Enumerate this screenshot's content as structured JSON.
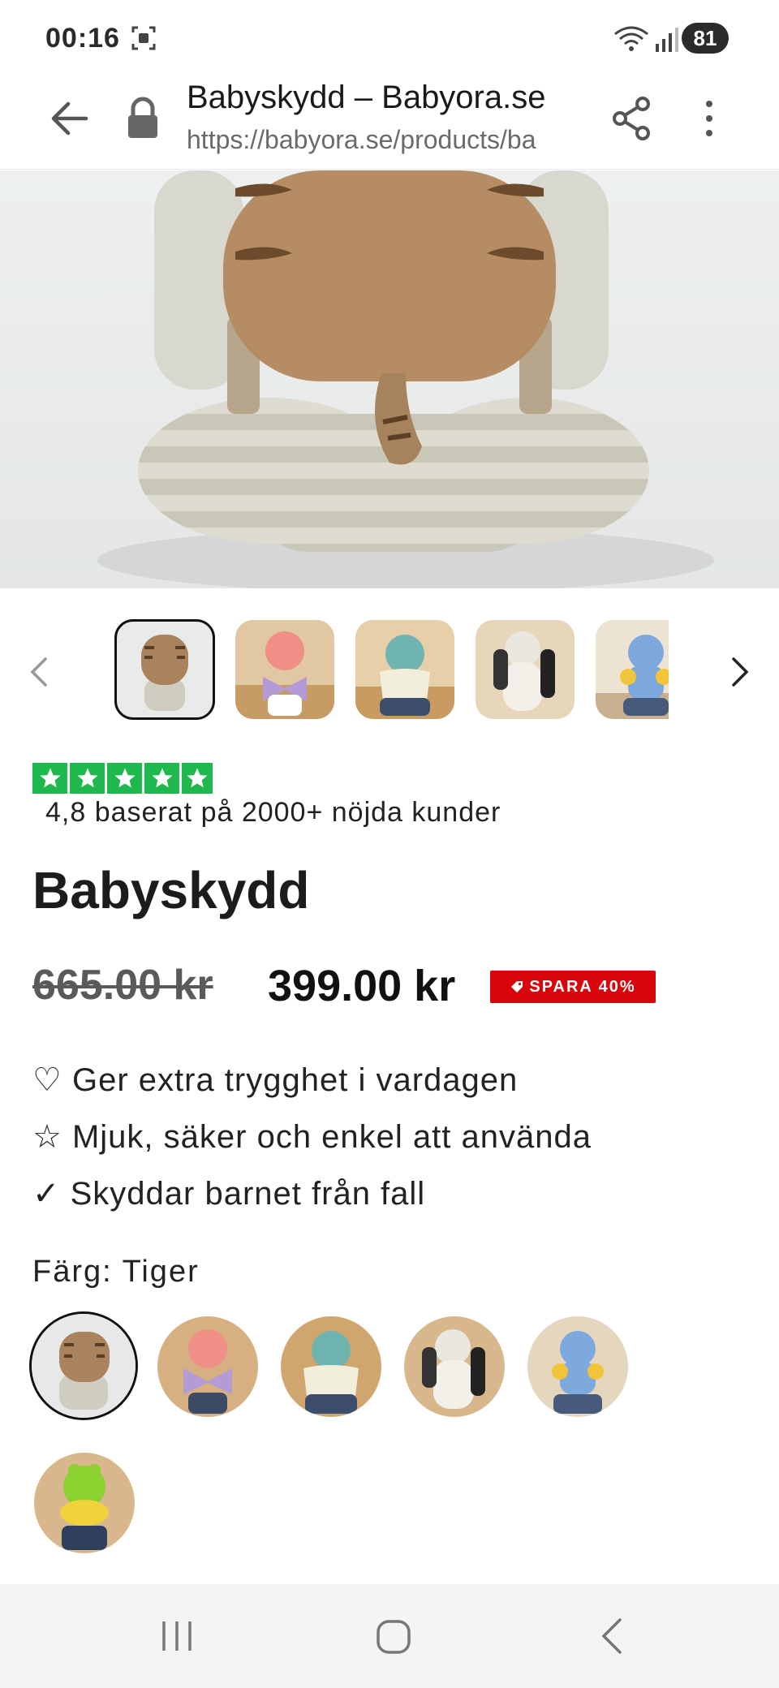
{
  "status_bar": {
    "time": "00:16",
    "battery": "81"
  },
  "browser": {
    "title": "Babyskydd – Babyora.se",
    "url": "https://babyora.se/products/ba"
  },
  "product": {
    "rating_text": "4,8 baserat på 2000+ nöjda kunder",
    "star_count": 5,
    "title": "Babyskydd",
    "old_price": "665.00 kr",
    "new_price": "399.00 kr",
    "save_badge": "SPARA 40%",
    "features": [
      "♡ Ger extra trygghet i vardagen",
      "☆ Mjuk, säker och enkel att använda",
      "✓ Skyddar barnet från fall"
    ],
    "color_label": "Färg: Tiger",
    "colors": {
      "rating_green": "#1fb84f",
      "badge_red": "#d9040b"
    }
  },
  "thumbnails": [
    "tiger",
    "pink-butterfly",
    "teal-bee",
    "white-panda",
    "blue-dino"
  ],
  "swatches": [
    "tiger",
    "pink-butterfly",
    "teal-bee",
    "white-panda",
    "blue-dino",
    "green-frog"
  ],
  "icons": {
    "back": "arrow-left-icon",
    "lock": "lock-icon",
    "share": "share-icon",
    "more": "more-vert-icon",
    "nav_recent": "recent-apps-icon",
    "nav_home": "home-icon",
    "nav_back": "chevron-left-icon"
  }
}
